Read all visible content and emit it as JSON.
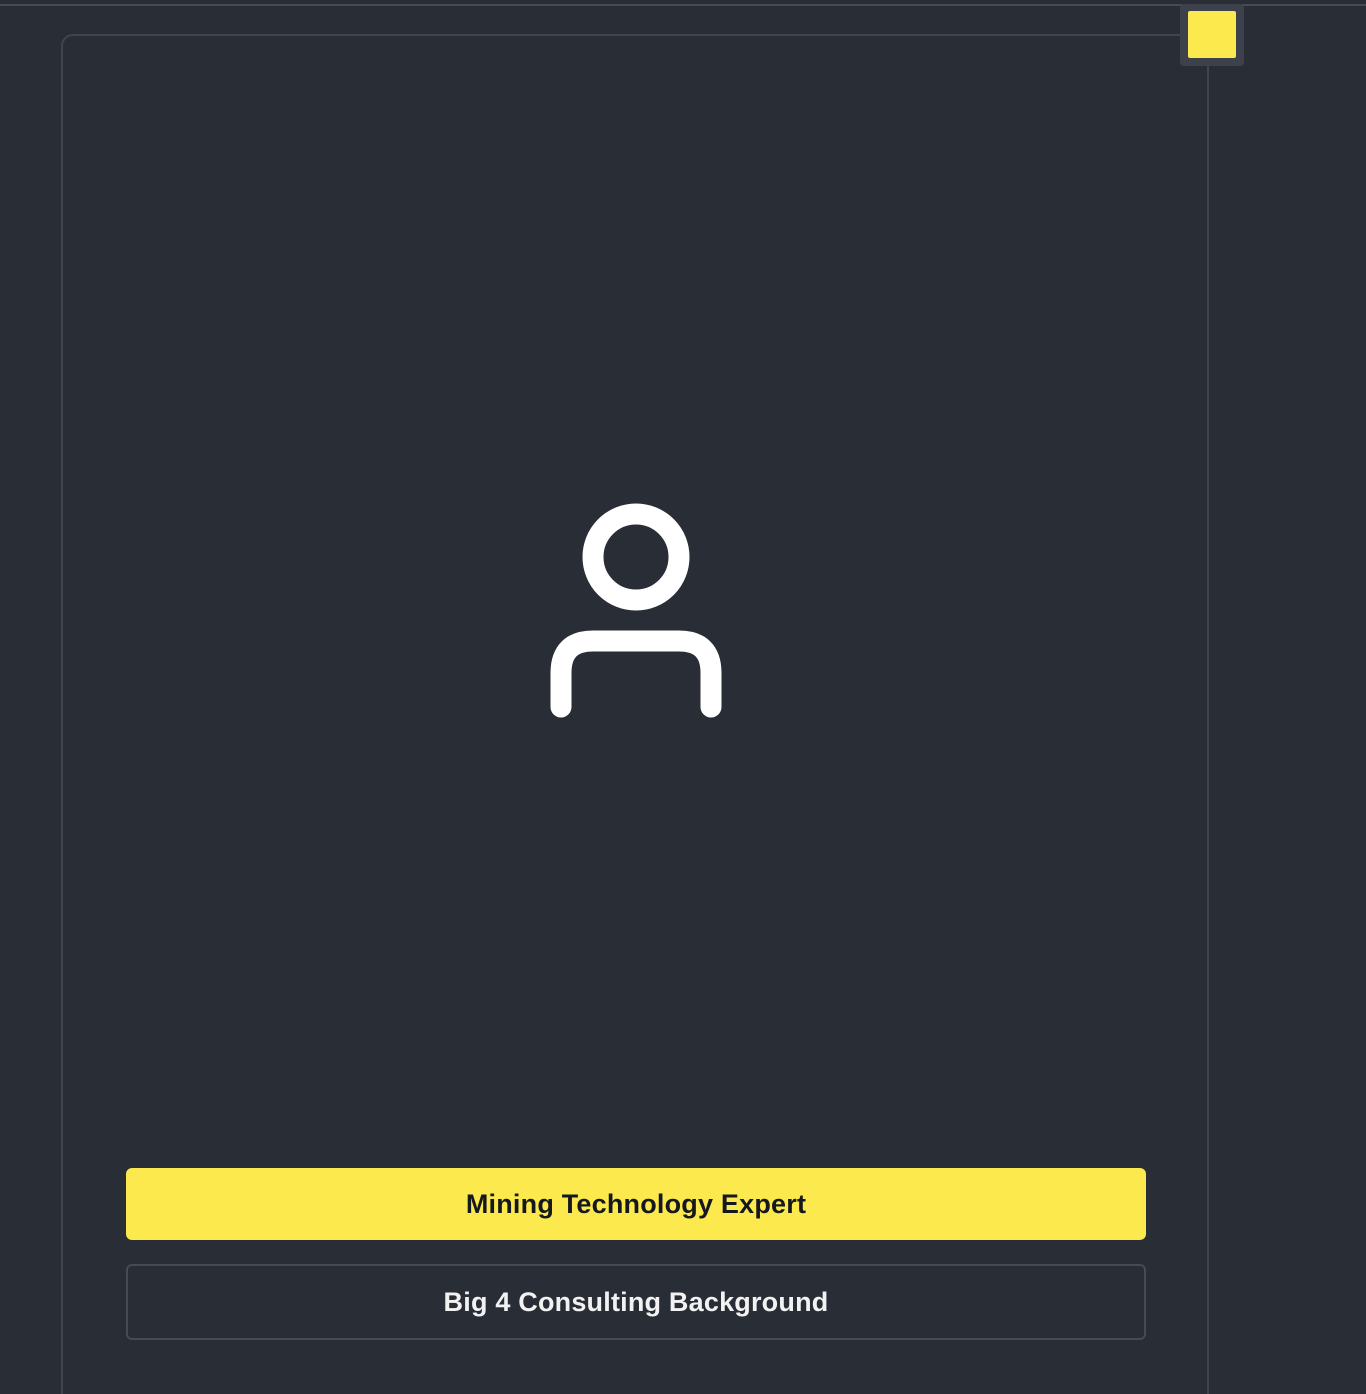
{
  "profile": {
    "avatar_icon": "user-icon",
    "primary_tag": "Mining Technology Expert",
    "secondary_tag": "Big 4 Consulting Background"
  },
  "theme": {
    "background": "#292d35",
    "accent": "#fbe94e",
    "border": "#3f444e",
    "icon_color": "#ffffff"
  },
  "corner_badge": {
    "icon": "yellow-square-icon"
  }
}
